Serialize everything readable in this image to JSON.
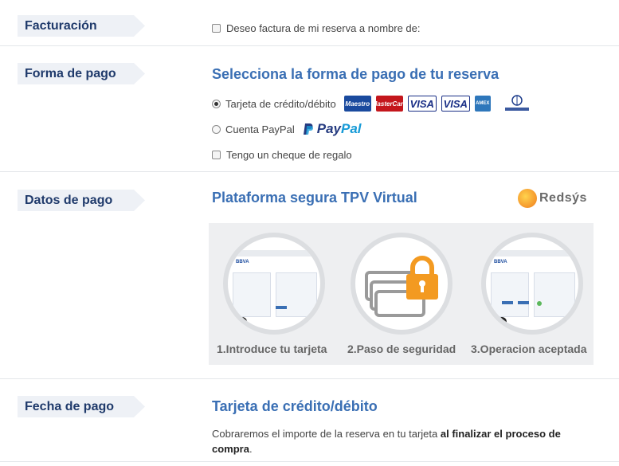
{
  "facturacion": {
    "tag": "Facturación",
    "checkbox_label": "Deseo factura de mi reserva a nombre de:"
  },
  "forma_pago": {
    "tag": "Forma de pago",
    "heading": "Selecciona la forma de pago de tu reserva",
    "options": [
      {
        "label": "Tarjeta de crédito/débito",
        "selected": true
      },
      {
        "label": "Cuenta PayPal",
        "selected": false
      }
    ],
    "gift_label": "Tengo un cheque de regalo",
    "card_logos": [
      "Maestro",
      "MasterCard",
      "VISA",
      "VISA",
      "AMEX",
      "Diners Club"
    ],
    "card_icons": [
      "maestro-icon",
      "mastercard-icon",
      "visa-electron-icon",
      "visa-icon",
      "amex-icon",
      "diners-club-icon"
    ],
    "paypal_logo": {
      "part1": "Pay",
      "part2": "Pal"
    }
  },
  "datos_pago": {
    "tag": "Datos de pago",
    "heading": "Plataforma segura TPV Virtual",
    "logo": "Redsýs",
    "steps": [
      {
        "caption": "1.Introduce tu tarjeta",
        "icon": "card-form-icon"
      },
      {
        "caption": "2.Paso de seguridad",
        "icon": "security-lock-icon"
      },
      {
        "caption": "3.Operacion aceptada",
        "icon": "confirmation-form-icon"
      }
    ]
  },
  "fecha_pago": {
    "tag": "Fecha de pago",
    "heading": "Tarjeta de crédito/débito",
    "text_normal": "Cobraremos el importe de la reserva en tu tarjeta ",
    "text_bold": "al finalizar el proceso de compra",
    "text_end": "."
  },
  "colors": {
    "tag_bg": "#eef1f6",
    "tag_text": "#1f3a6b",
    "heading": "#3a6fb4",
    "panel_bg": "#eeeff1",
    "lock": "#f39a21"
  }
}
